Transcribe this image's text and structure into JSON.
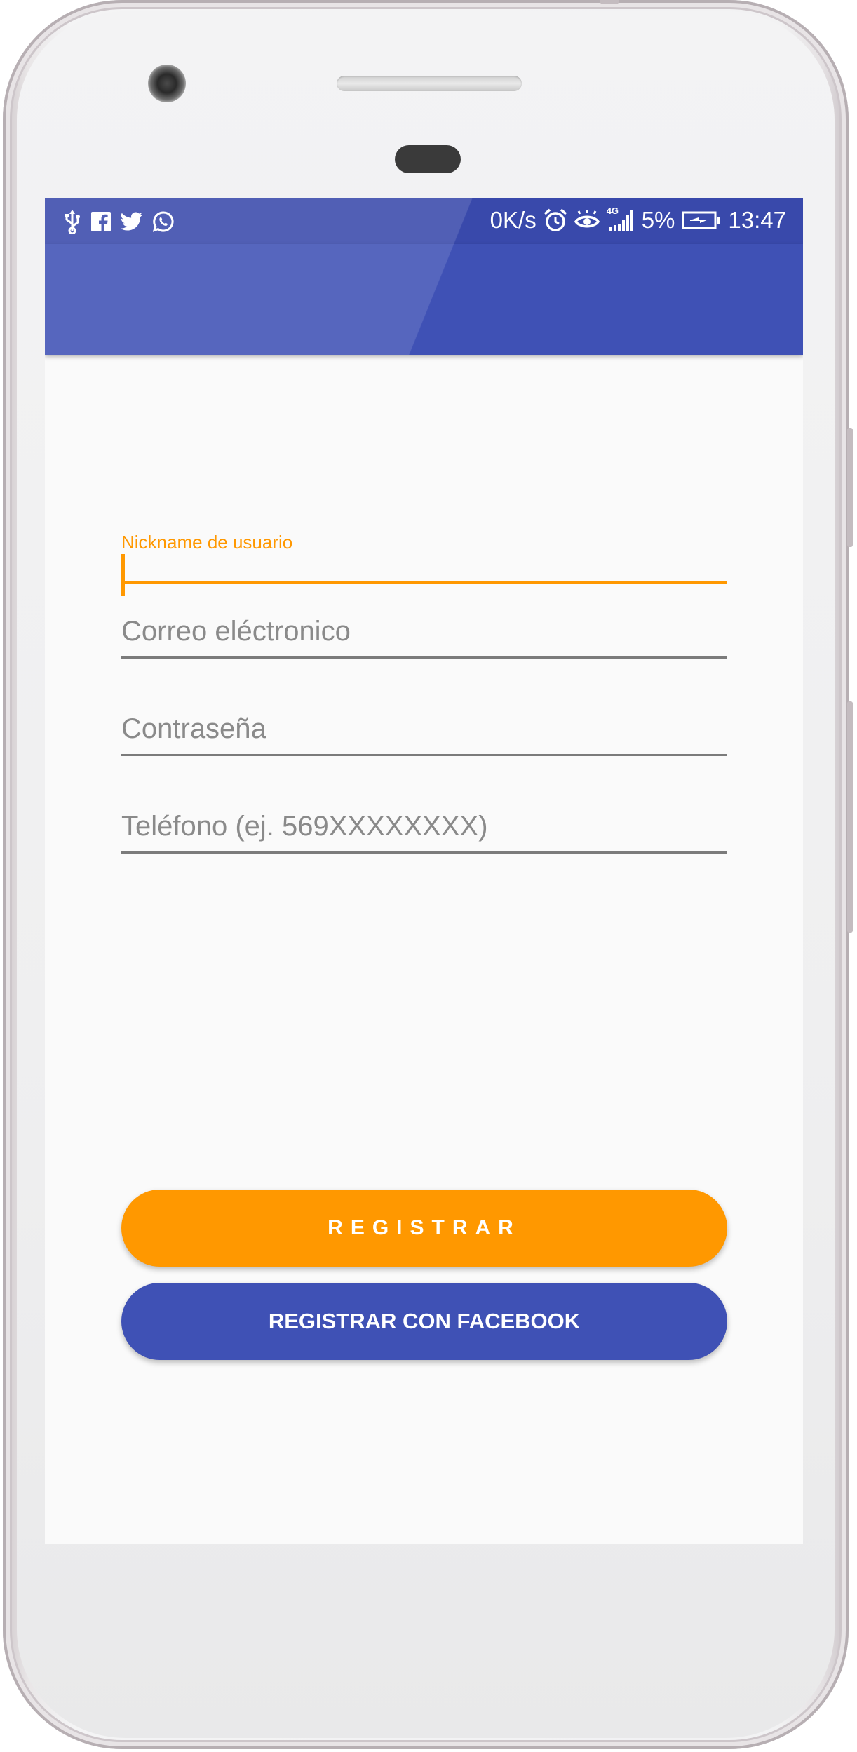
{
  "status_bar": {
    "net_speed": "0K/s",
    "network_type": "4G",
    "battery": "5%",
    "time": "13:47",
    "left_icons": [
      "usb-icon",
      "facebook-icon",
      "twitter-icon",
      "whatsapp-icon"
    ],
    "right_icons": [
      "alarm-icon",
      "eye-icon",
      "signal-icon",
      "battery-charging-icon"
    ]
  },
  "app_bar": {
    "color": "#3f51b5",
    "status_color": "#3949ab"
  },
  "form": {
    "nickname": {
      "label": "Nickname de usuario",
      "value": ""
    },
    "email": {
      "placeholder": "Correo eléctronico"
    },
    "password": {
      "placeholder": "Contraseña"
    },
    "phone": {
      "placeholder": "Teléfono (ej. 569XXXXXXXX)"
    }
  },
  "buttons": {
    "register_label": "REGISTRAR",
    "facebook_label": "REGISTRAR CON FACEBOOK"
  },
  "colors": {
    "accent": "#ff9800",
    "primary": "#3f51b5",
    "background": "#fafafa"
  }
}
